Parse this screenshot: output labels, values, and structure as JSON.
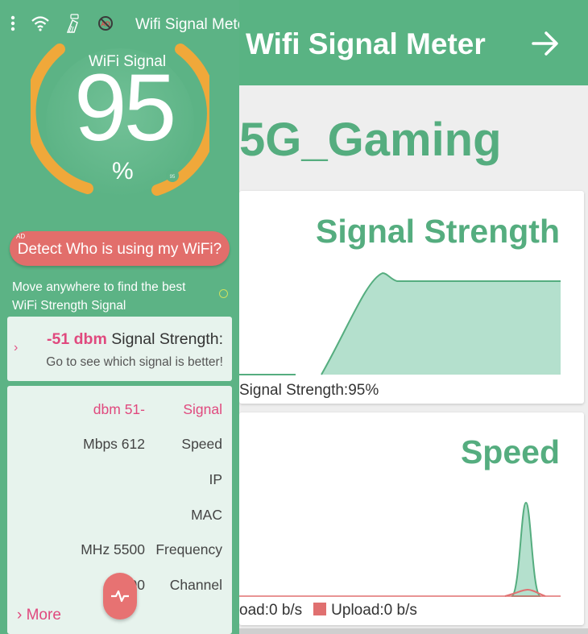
{
  "right": {
    "app_title": "Wifi Signal Meter",
    "network_name": "5G_Gaming",
    "signal_card": {
      "title": "Signal Strength",
      "legend": "Signal Strength:95%"
    },
    "speed_card": {
      "title": "Speed",
      "download_legend": "oad:0 b/s",
      "upload_legend": "Upload:0 b/s"
    },
    "colors": {
      "accent": "#59b383",
      "upload": "#e07070",
      "fill": "#b4e0cd"
    }
  },
  "left": {
    "app_title": "Wifi Signal Meter",
    "status_icons": [
      "more-vert-icon",
      "wifi-icon",
      "ad-broom-icon",
      "no-ads-icon"
    ],
    "gauge": {
      "label": "WiFi Signal",
      "value": "95",
      "unit": "%",
      "level": 0.95,
      "ring_color": "#f0a83a"
    },
    "detect_button": {
      "ad_tag": "AD",
      "label": "Detect Who is using my WiFi?"
    },
    "hint": "Move anywhere to find the best WiFi Strength Signal",
    "strength": {
      "dbm": "-51 dbm",
      "label": " Signal Strength:",
      "sub": "Go to see which signal is better!"
    },
    "details": {
      "rows": [
        {
          "key": "Signal",
          "value": "dbm 51-"
        },
        {
          "key": "Speed",
          "value": "Mbps 612"
        },
        {
          "key": "IP",
          "value": ""
        },
        {
          "key": "MAC",
          "value": ""
        },
        {
          "key": "Frequency",
          "value": "MHz 5500"
        },
        {
          "key": "Channel",
          "value": "00"
        }
      ],
      "more": "More"
    },
    "colors": {
      "bg": "#5cb385",
      "pink": "#e0497e",
      "button": "#e26e6b"
    }
  }
}
